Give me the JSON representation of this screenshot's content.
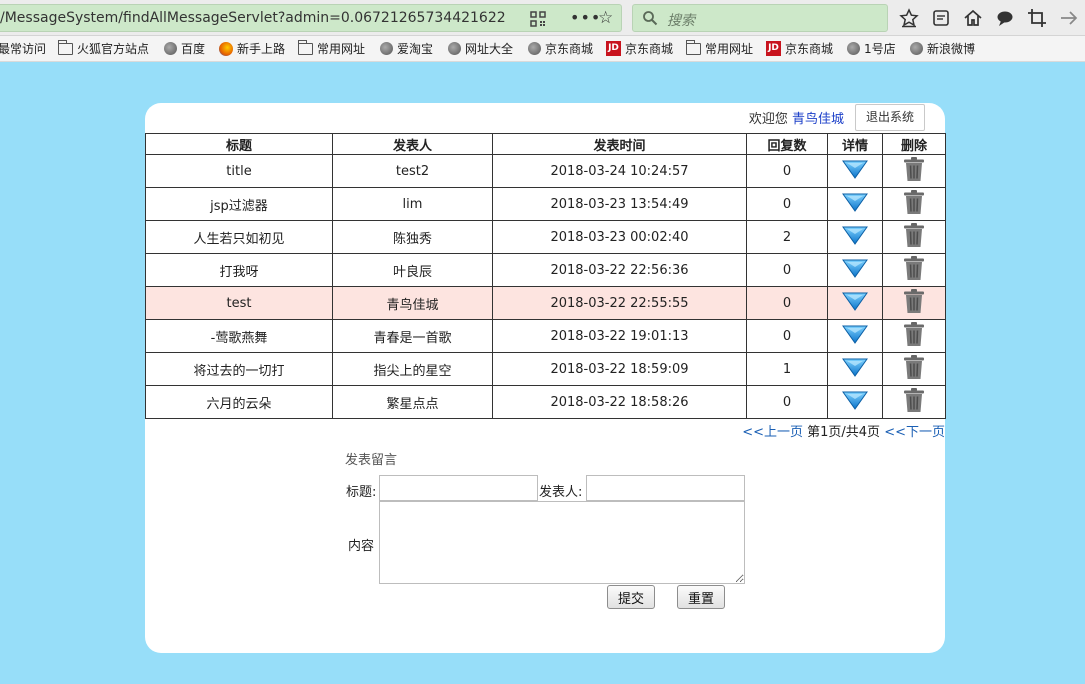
{
  "browser": {
    "url": "/MessageSystem/findAllMessageServlet?admin=0.06721265734421622",
    "search_placeholder": "搜索",
    "more_glyph": "•••",
    "bookmarks": [
      "最常访问",
      "火狐官方站点",
      "百度",
      "新手上路",
      "常用网址",
      "爱淘宝",
      "网址大全",
      "京东商城",
      "京东商城",
      "常用网址",
      "京东商城",
      "1号店",
      "新浪微博"
    ],
    "jd_badge": "JD"
  },
  "header": {
    "welcome_prefix": "欢迎您",
    "username": "青鸟佳城",
    "logout_label": "退出系统"
  },
  "table": {
    "columns": [
      "标题",
      "发表人",
      "发表时间",
      "回复数",
      "详情",
      "删除"
    ],
    "rows": [
      {
        "title": "title",
        "author": "test2",
        "time": "2018-03-24 10:24:57",
        "replies": "0"
      },
      {
        "title": "jsp过滤器",
        "author": "lim",
        "time": "2018-03-23 13:54:49",
        "replies": "0"
      },
      {
        "title": "人生若只如初见",
        "author": "陈独秀",
        "time": "2018-03-23 00:02:40",
        "replies": "2"
      },
      {
        "title": "打我呀",
        "author": "叶良辰",
        "time": "2018-03-22 22:56:36",
        "replies": "0"
      },
      {
        "title": "test",
        "author": "青鸟佳城",
        "time": "2018-03-22 22:55:55",
        "replies": "0"
      },
      {
        "title": "-莺歌燕舞",
        "author": "青春是一首歌",
        "time": "2018-03-22 19:01:13",
        "replies": "0"
      },
      {
        "title": "将过去的一切打",
        "author": "指尖上的星空",
        "time": "2018-03-22 18:59:09",
        "replies": "1"
      },
      {
        "title": "六月的云朵",
        "author": "繁星点点",
        "time": "2018-03-22 18:58:26",
        "replies": "0"
      }
    ],
    "highlighted_row": 4
  },
  "pager": {
    "prev_label": "<<上一页",
    "status": "第1页/共4页",
    "next_label": "<<下一页"
  },
  "form": {
    "heading": "发表留言",
    "title_label": "标题:",
    "title_value": "",
    "author_label": "发表人:",
    "author_value": "",
    "content_label": "内容",
    "content_value": "",
    "submit_label": "提交",
    "reset_label": "重置"
  },
  "icons": {
    "detail": "blue-down-arrow-icon",
    "delete": "trash-icon"
  },
  "colors": {
    "page_bg": "#97def9",
    "highlight_row": "#fde4e0",
    "link": "#1a5fb4",
    "username": "#1a3ec8",
    "url_bg": "#cde8c9"
  }
}
